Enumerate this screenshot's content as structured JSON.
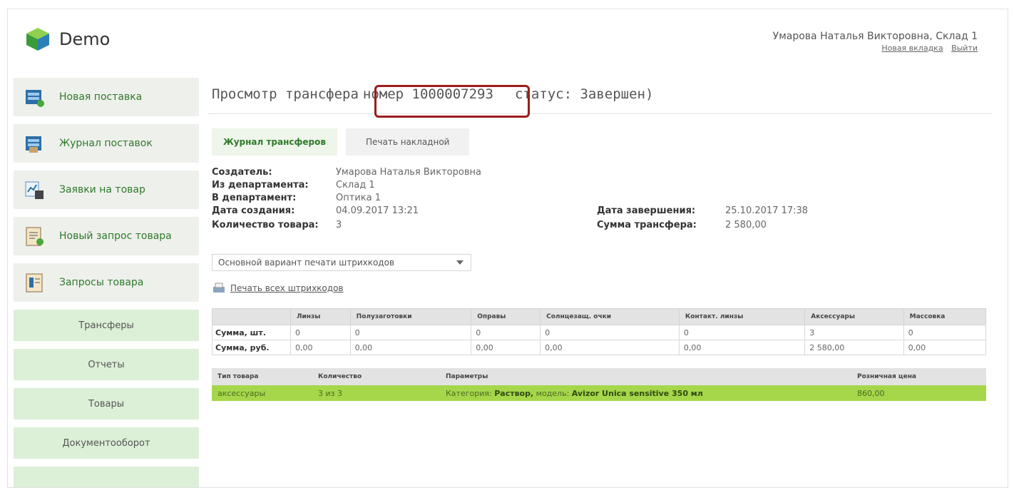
{
  "header": {
    "app_name": "Demo",
    "user": "Умарова Наталья Викторовна, Склад 1",
    "link_new_tab": "Новая вкладка",
    "link_logout": "Выйти"
  },
  "sidebar": {
    "main_items": [
      {
        "label": "Новая поставка",
        "icon": "truck-box-icon"
      },
      {
        "label": "Журнал поставок",
        "icon": "truck-journal-icon"
      },
      {
        "label": "Заявки на товар",
        "icon": "chart-request-icon"
      },
      {
        "label": "Новый запрос товара",
        "icon": "clipboard-add-icon"
      },
      {
        "label": "Запросы товара",
        "icon": "requests-doc-icon"
      }
    ],
    "sub_items": [
      "Трансферы",
      "Отчеты",
      "Товары",
      "Документооборот"
    ]
  },
  "page": {
    "title_prefix": "Просмотр трансфера",
    "title_number": "номер 1000007293",
    "title_status": "статус: Завершен)"
  },
  "tabs": {
    "journal": "Журнал трансферов",
    "print_invoice": "Печать накладной"
  },
  "info": {
    "creator_label": "Создатель:",
    "creator": "Умарова Наталья Викторовна",
    "from_label": "Из департамента:",
    "from": "Склад 1",
    "to_label": "В департамент:",
    "to": "Оптика 1",
    "created_label": "Дата создания:",
    "created": "04.09.2017 13:21",
    "qty_label": "Количество товара:",
    "qty": "3",
    "completed_label": "Дата завершения:",
    "completed": "25.10.2017 17:38",
    "sum_label": "Сумма трансфера:",
    "sum": "2 580,00"
  },
  "barcode": {
    "select_value": "Основной вариант печати штрихкодов",
    "print_all": "Печать всех штрихкодов"
  },
  "summary": {
    "columns": [
      "",
      "Линзы",
      "Полузаготовки",
      "Оправы",
      "Солнцезащ. очки",
      "Контакт. линзы",
      "Аксессуары",
      "Массовка"
    ],
    "rows": [
      [
        "Сумма, шт.",
        "0",
        "0",
        "0",
        "0",
        "0",
        "3",
        "0"
      ],
      [
        "Сумма, руб.",
        "0,00",
        "0,00",
        "0,00",
        "0,00",
        "0,00",
        "2 580,00",
        "0,00"
      ]
    ]
  },
  "items": {
    "columns": [
      "Тип товара",
      "Количество",
      "Параметры",
      "Розничная цена"
    ],
    "row": {
      "type": "аксессуары",
      "qty": "3 из 3",
      "cat_label": "Категория:",
      "cat_value": "Раствор,",
      "model_label": "модель:",
      "model_value": "Avizor Unica sensitive 350 мл",
      "price": "860,00"
    }
  }
}
